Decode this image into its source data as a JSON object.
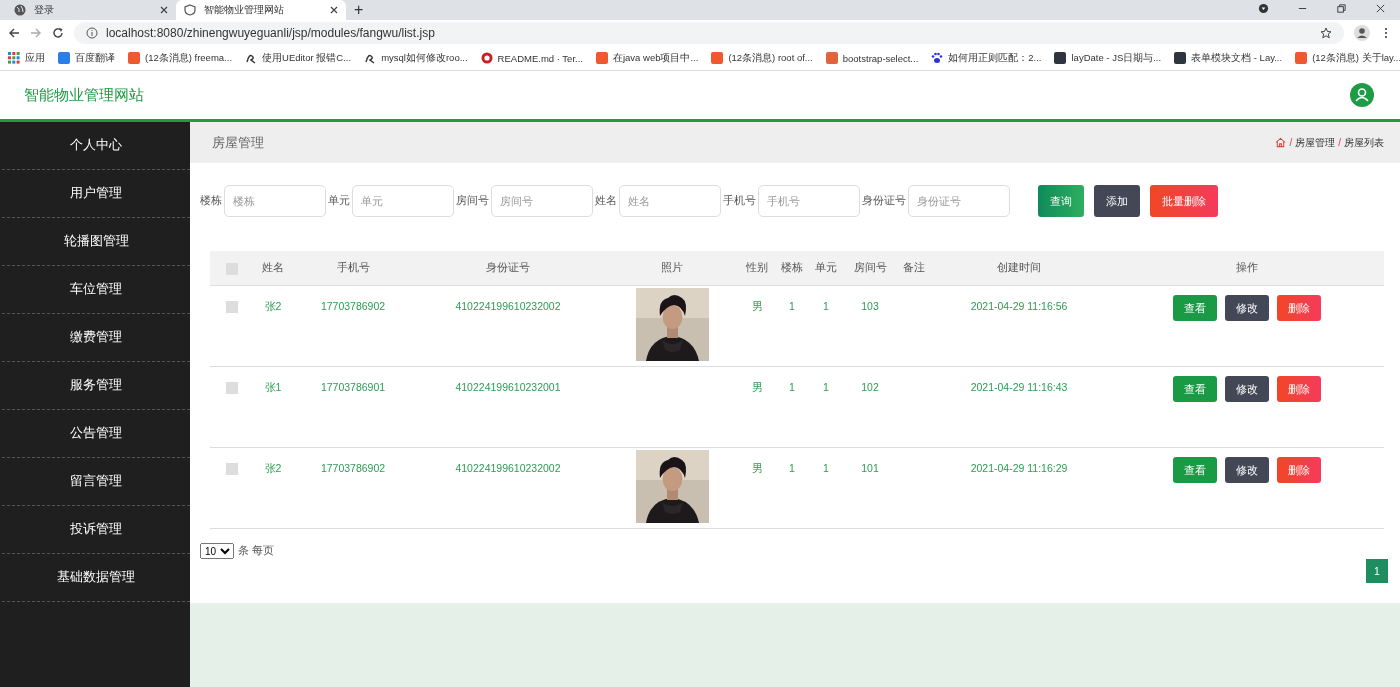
{
  "browser": {
    "tabs": [
      {
        "title": "登录",
        "selected": false
      },
      {
        "title": "智能物业管理网站",
        "selected": true
      }
    ],
    "new_tab": "+",
    "address": "localhost:8080/zhinengwuyeguanli/jsp/modules/fangwu/list.jsp",
    "bookmarks": [
      {
        "label": "应用",
        "kind": "apps"
      },
      {
        "label": "百度翻译",
        "kind": "tile",
        "color": "#2b7de9"
      },
      {
        "label": "(12条消息) freema...",
        "kind": "tile",
        "color": "#f0582f"
      },
      {
        "label": "使用UEditor 报错C...",
        "kind": "hook"
      },
      {
        "label": "mysql如何修改roo...",
        "kind": "hook"
      },
      {
        "label": "README.md · Ter...",
        "kind": "ring",
        "color": "#c71d23"
      },
      {
        "label": "在java web项目中...",
        "kind": "tile",
        "color": "#f0582f"
      },
      {
        "label": "(12条消息) root of...",
        "kind": "tile",
        "color": "#f0582f"
      },
      {
        "label": "bootstrap-select...",
        "kind": "tile",
        "color": "#e0633d"
      },
      {
        "label": "如何用正则匹配：2...",
        "kind": "paw"
      },
      {
        "label": "layDate - JS日期与...",
        "kind": "tile",
        "color": "#2f3441"
      },
      {
        "label": "表单模块文档 - Lay...",
        "kind": "tile",
        "color": "#2f3441"
      },
      {
        "label": "(12条消息) 关于lay...",
        "kind": "tile",
        "color": "#f0582f"
      }
    ]
  },
  "site_title": "智能物业管理网站",
  "sidebar": {
    "items": [
      "个人中心",
      "用户管理",
      "轮播图管理",
      "车位管理",
      "缴费管理",
      "服务管理",
      "公告管理",
      "留言管理",
      "投诉管理",
      "基础数据管理"
    ]
  },
  "page_title": "房屋管理",
  "breadcrumb": [
    {
      "separator": "/",
      "label": "房屋管理"
    },
    {
      "separator": "/",
      "label": "房屋列表"
    }
  ],
  "filters": [
    {
      "label": "楼栋",
      "placeholder": "楼栋"
    },
    {
      "label": "单元",
      "placeholder": "单元"
    },
    {
      "label": "房间号",
      "placeholder": "房间号"
    },
    {
      "label": "姓名",
      "placeholder": "姓名"
    },
    {
      "label": "手机号",
      "placeholder": "手机号"
    },
    {
      "label": "身份证号",
      "placeholder": "身份证号"
    }
  ],
  "actions": [
    {
      "label": "查询",
      "kind": "search"
    },
    {
      "label": "添加",
      "kind": "add"
    },
    {
      "label": "批量删除",
      "kind": "delete"
    }
  ],
  "table": {
    "select_all": false,
    "columns": [
      "姓名",
      "手机号",
      "身份证号",
      "照片",
      "性别",
      "楼栋",
      "单元",
      "房间号",
      "备注",
      "创建时间",
      "操作"
    ],
    "rows": [
      {
        "selected": false,
        "name": "张2",
        "phone": "17703786902",
        "id_number": "410224199610232002",
        "photo": true,
        "gender": "男",
        "building": "1",
        "unit": "1",
        "room": "103",
        "created": "2021-04-29 11:16:56",
        "buttons": [
          {
            "label": "查看",
            "kind": "view"
          },
          {
            "label": "修改",
            "kind": "edit"
          },
          {
            "label": "删除",
            "kind": "delete"
          }
        ]
      },
      {
        "selected": false,
        "name": "张1",
        "phone": "17703786901",
        "id_number": "410224199610232001",
        "photo": false,
        "gender": "男",
        "building": "1",
        "unit": "1",
        "room": "102",
        "created": "2021-04-29 11:16:43",
        "buttons": [
          {
            "label": "查看",
            "kind": "view"
          },
          {
            "label": "修改",
            "kind": "edit"
          },
          {
            "label": "删除",
            "kind": "delete"
          }
        ]
      },
      {
        "selected": false,
        "name": "张2",
        "phone": "17703786902",
        "id_number": "410224199610232002",
        "photo": true,
        "gender": "男",
        "building": "1",
        "unit": "1",
        "room": "101",
        "created": "2021-04-29 11:16:29",
        "buttons": [
          {
            "label": "查看",
            "kind": "view"
          },
          {
            "label": "修改",
            "kind": "edit"
          },
          {
            "label": "删除",
            "kind": "delete"
          }
        ]
      }
    ]
  },
  "page_size": {
    "value": "10",
    "suffix": "条 每页"
  },
  "pages": [
    {
      "label": "1",
      "selected": true
    }
  ]
}
